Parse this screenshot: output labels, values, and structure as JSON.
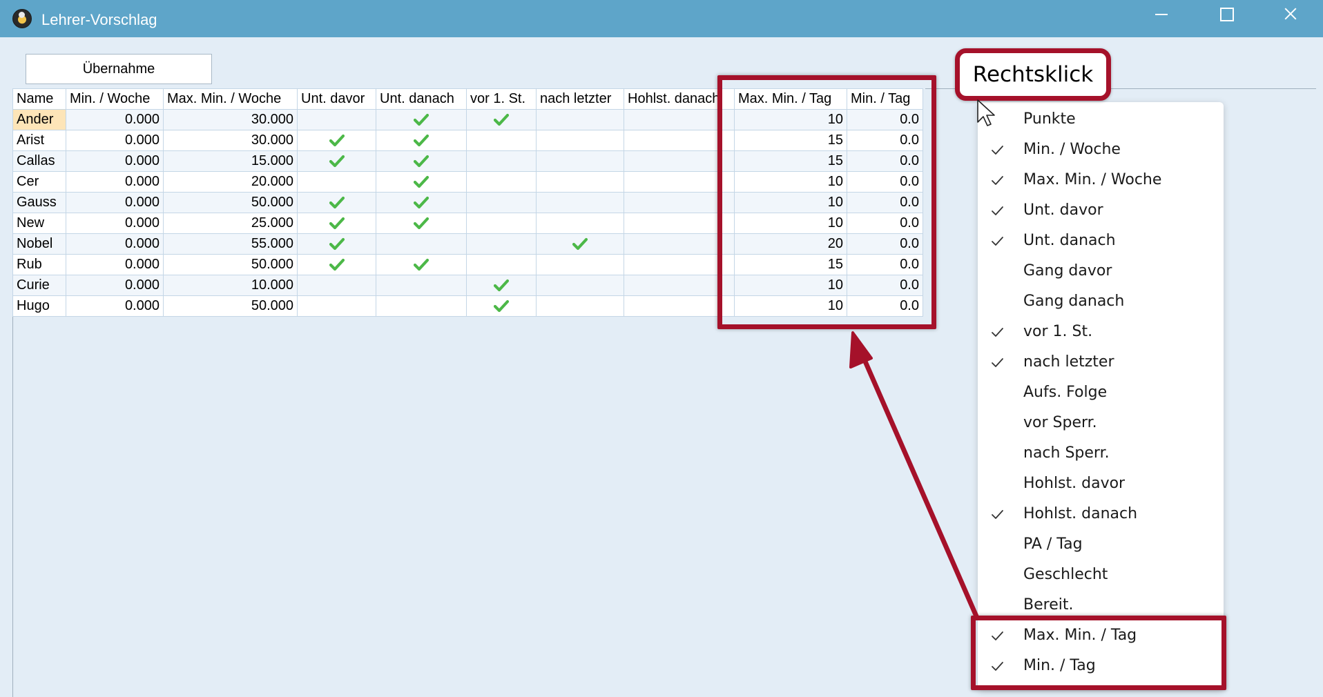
{
  "window": {
    "title": "Lehrer-Vorschlag"
  },
  "toolbar": {
    "uebernahme_label": "Übernahme"
  },
  "table": {
    "columns": [
      "Name",
      "Min. / Woche",
      "Max. Min. / Woche",
      "Unt. davor",
      "Unt. danach",
      "vor 1. St.",
      "nach letzter",
      "Hohlst. danach",
      "Max. Min. / Tag",
      "Min. / Tag"
    ],
    "rows": [
      {
        "name": "Ander",
        "min_woche": "0.000",
        "max_min_woche": "30.000",
        "unt_davor": false,
        "unt_danach": true,
        "vor_1_st": true,
        "nach_letzter": false,
        "hohlst_danach": false,
        "max_min_tag": "10",
        "min_tag": "0.0"
      },
      {
        "name": "Arist",
        "min_woche": "0.000",
        "max_min_woche": "30.000",
        "unt_davor": true,
        "unt_danach": true,
        "vor_1_st": false,
        "nach_letzter": false,
        "hohlst_danach": false,
        "max_min_tag": "15",
        "min_tag": "0.0"
      },
      {
        "name": "Callas",
        "min_woche": "0.000",
        "max_min_woche": "15.000",
        "unt_davor": true,
        "unt_danach": true,
        "vor_1_st": false,
        "nach_letzter": false,
        "hohlst_danach": false,
        "max_min_tag": "15",
        "min_tag": "0.0"
      },
      {
        "name": "Cer",
        "min_woche": "0.000",
        "max_min_woche": "20.000",
        "unt_davor": false,
        "unt_danach": true,
        "vor_1_st": false,
        "nach_letzter": false,
        "hohlst_danach": false,
        "max_min_tag": "10",
        "min_tag": "0.0"
      },
      {
        "name": "Gauss",
        "min_woche": "0.000",
        "max_min_woche": "50.000",
        "unt_davor": true,
        "unt_danach": true,
        "vor_1_st": false,
        "nach_letzter": false,
        "hohlst_danach": false,
        "max_min_tag": "10",
        "min_tag": "0.0"
      },
      {
        "name": "New",
        "min_woche": "0.000",
        "max_min_woche": "25.000",
        "unt_davor": true,
        "unt_danach": true,
        "vor_1_st": false,
        "nach_letzter": false,
        "hohlst_danach": false,
        "max_min_tag": "10",
        "min_tag": "0.0"
      },
      {
        "name": "Nobel",
        "min_woche": "0.000",
        "max_min_woche": "55.000",
        "unt_davor": true,
        "unt_danach": false,
        "vor_1_st": false,
        "nach_letzter": true,
        "hohlst_danach": false,
        "max_min_tag": "20",
        "min_tag": "0.0"
      },
      {
        "name": "Rub",
        "min_woche": "0.000",
        "max_min_woche": "50.000",
        "unt_davor": true,
        "unt_danach": true,
        "vor_1_st": false,
        "nach_letzter": false,
        "hohlst_danach": false,
        "max_min_tag": "15",
        "min_tag": "0.0"
      },
      {
        "name": "Curie",
        "min_woche": "0.000",
        "max_min_woche": "10.000",
        "unt_davor": false,
        "unt_danach": false,
        "vor_1_st": true,
        "nach_letzter": false,
        "hohlst_danach": false,
        "max_min_tag": "10",
        "min_tag": "0.0"
      },
      {
        "name": "Hugo",
        "min_woche": "0.000",
        "max_min_woche": "50.000",
        "unt_davor": false,
        "unt_danach": false,
        "vor_1_st": true,
        "nach_letzter": false,
        "hohlst_danach": false,
        "max_min_tag": "10",
        "min_tag": "0.0"
      }
    ],
    "selected_row": "Ander"
  },
  "annotation": {
    "callout_text": "Rechtsklick"
  },
  "context_menu": {
    "items": [
      {
        "label": "Punkte",
        "checked": false
      },
      {
        "label": "Min. / Woche",
        "checked": true
      },
      {
        "label": "Max. Min. / Woche",
        "checked": true
      },
      {
        "label": "Unt. davor",
        "checked": true
      },
      {
        "label": "Unt. danach",
        "checked": true
      },
      {
        "label": "Gang davor",
        "checked": false
      },
      {
        "label": "Gang danach",
        "checked": false
      },
      {
        "label": "vor 1. St.",
        "checked": true
      },
      {
        "label": "nach letzter",
        "checked": true
      },
      {
        "label": "Aufs. Folge",
        "checked": false
      },
      {
        "label": "vor Sperr.",
        "checked": false
      },
      {
        "label": "nach Sperr.",
        "checked": false
      },
      {
        "label": "Hohlst. davor",
        "checked": false
      },
      {
        "label": "Hohlst. danach",
        "checked": true
      },
      {
        "label": "PA / Tag",
        "checked": false
      },
      {
        "label": "Geschlecht",
        "checked": false
      },
      {
        "label": "Bereit.",
        "checked": false
      },
      {
        "label": "Max. Min. / Tag",
        "checked": true
      },
      {
        "label": "Min. / Tag",
        "checked": true
      }
    ]
  },
  "icons": {
    "app": "app-logo-icon",
    "check": "green-check-icon",
    "menu_check": "menu-check-icon",
    "cursor": "mouse-pointer-icon"
  },
  "colors": {
    "titlebar": "#5ea5c9",
    "background": "#e3edf6",
    "check_green": "#4cb848",
    "highlight_red": "#a5112a",
    "selected_name": "#fde5b8"
  }
}
